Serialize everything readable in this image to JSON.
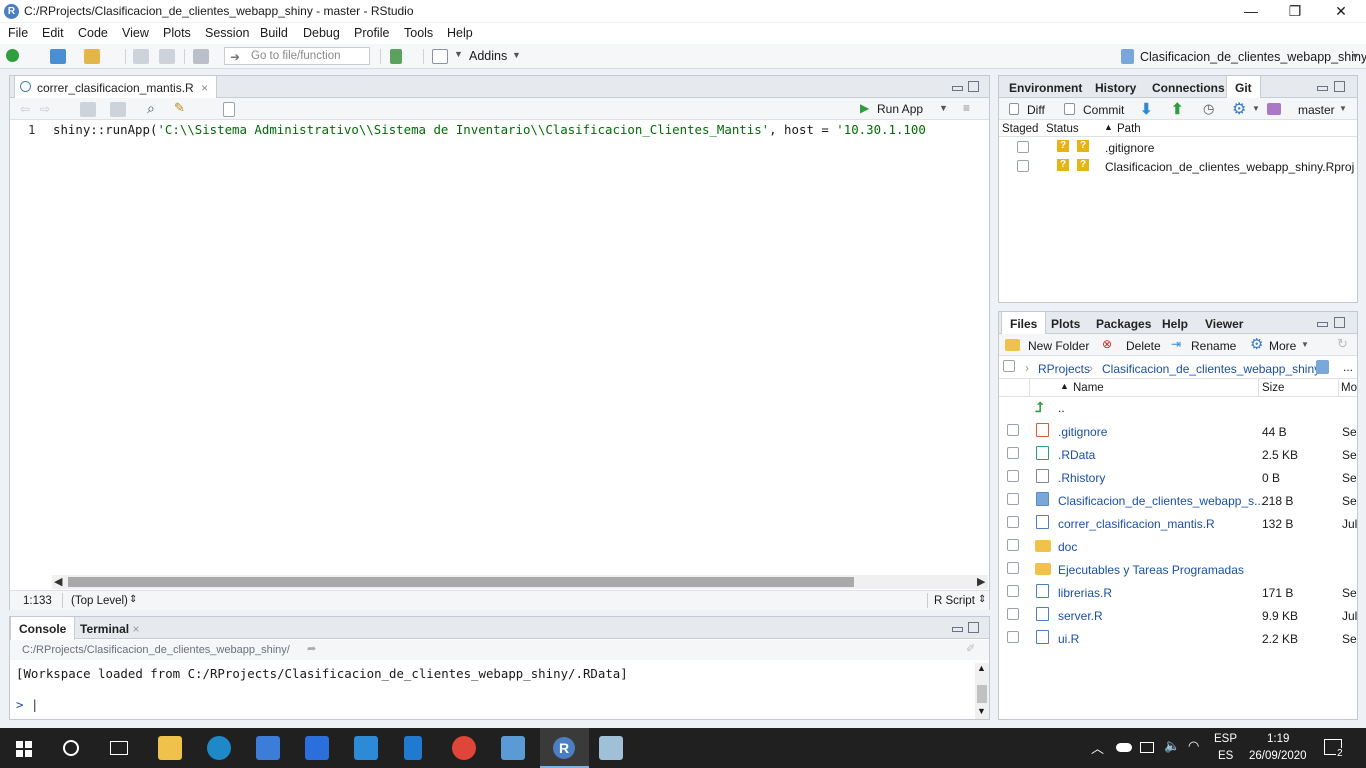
{
  "window": {
    "title": "C:/RProjects/Clasificacion_de_clientes_webapp_shiny - master - RStudio",
    "controls": {
      "minimize": "—",
      "restore": "❐",
      "close": "✕"
    }
  },
  "menu": [
    "File",
    "Edit",
    "Code",
    "View",
    "Plots",
    "Session",
    "Build",
    "Debug",
    "Profile",
    "Tools",
    "Help"
  ],
  "toolbar": {
    "goto_placeholder": "Go to file/function",
    "addins_label": "Addins",
    "project_label": "Clasificacion_de_clientes_webapp_shiny"
  },
  "editor": {
    "tab_label": "correr_clasificacion_mantis.R",
    "tab_close": "×",
    "run_app_label": "Run App",
    "line_number": "1",
    "code_prefix": "shiny::runApp(",
    "code_string": "'C:\\\\Sistema Administrativo\\\\Sistema de Inventario\\\\Clasificacion_Clientes_Mantis'",
    "code_suffix": ", host = ",
    "code_string2": "'10.30.1.100",
    "cursor_position": "1:133",
    "scope": "(Top Level)",
    "file_type": "R Script"
  },
  "console": {
    "tabs": [
      "Console",
      "Terminal"
    ],
    "path": "C:/RProjects/Clasificacion_de_clientes_webapp_shiny/",
    "output": "[Workspace loaded from C:/RProjects/Clasificacion_de_clientes_webapp_shiny/.RData]",
    "prompt": ">"
  },
  "git_pane": {
    "tabs": [
      "Environment",
      "History",
      "Connections",
      "Git"
    ],
    "toolbar": {
      "diff": "Diff",
      "commit": "Commit",
      "branch": "master"
    },
    "columns": {
      "staged": "Staged",
      "status": "Status",
      "path": "Path"
    },
    "rows": [
      {
        "path": ".gitignore",
        "status": "?"
      },
      {
        "path": "Clasificacion_de_clientes_webapp_shiny.Rproj",
        "status": "?"
      }
    ]
  },
  "files_pane": {
    "tabs": [
      "Files",
      "Plots",
      "Packages",
      "Help",
      "Viewer"
    ],
    "toolbar": {
      "new_folder": "New Folder",
      "delete": "Delete",
      "rename": "Rename",
      "more": "More"
    },
    "breadcrumb": [
      "RProjects",
      "Clasificacion_de_clientes_webapp_shiny"
    ],
    "breadcrumb_more": "...",
    "columns": {
      "name": "Name",
      "size": "Size",
      "modified": "Mo"
    },
    "up_label": "..",
    "rows": [
      {
        "name": ".gitignore",
        "size": "44 B",
        "modified": "Se",
        "kind": "git"
      },
      {
        "name": ".RData",
        "size": "2.5 KB",
        "modified": "Se",
        "kind": "rdata"
      },
      {
        "name": ".Rhistory",
        "size": "0 B",
        "modified": "Se",
        "kind": "file"
      },
      {
        "name": "Clasificacion_de_clientes_webapp_s...",
        "size": "218 B",
        "modified": "Se",
        "kind": "rproj"
      },
      {
        "name": "correr_clasificacion_mantis.R",
        "size": "132 B",
        "modified": "Jul",
        "kind": "r"
      },
      {
        "name": "doc",
        "size": "",
        "modified": "",
        "kind": "folder"
      },
      {
        "name": "Ejecutables y Tareas Programadas",
        "size": "",
        "modified": "",
        "kind": "folder"
      },
      {
        "name": "librerias.R",
        "size": "171 B",
        "modified": "Se",
        "kind": "r"
      },
      {
        "name": "server.R",
        "size": "9.9 KB",
        "modified": "Jul",
        "kind": "r"
      },
      {
        "name": "ui.R",
        "size": "2.2 KB",
        "modified": "Se",
        "kind": "r"
      }
    ]
  },
  "taskbar": {
    "lang_top": "ESP",
    "lang_bottom": "ES",
    "time": "1:19",
    "date": "26/09/2020",
    "notifications": "2"
  }
}
